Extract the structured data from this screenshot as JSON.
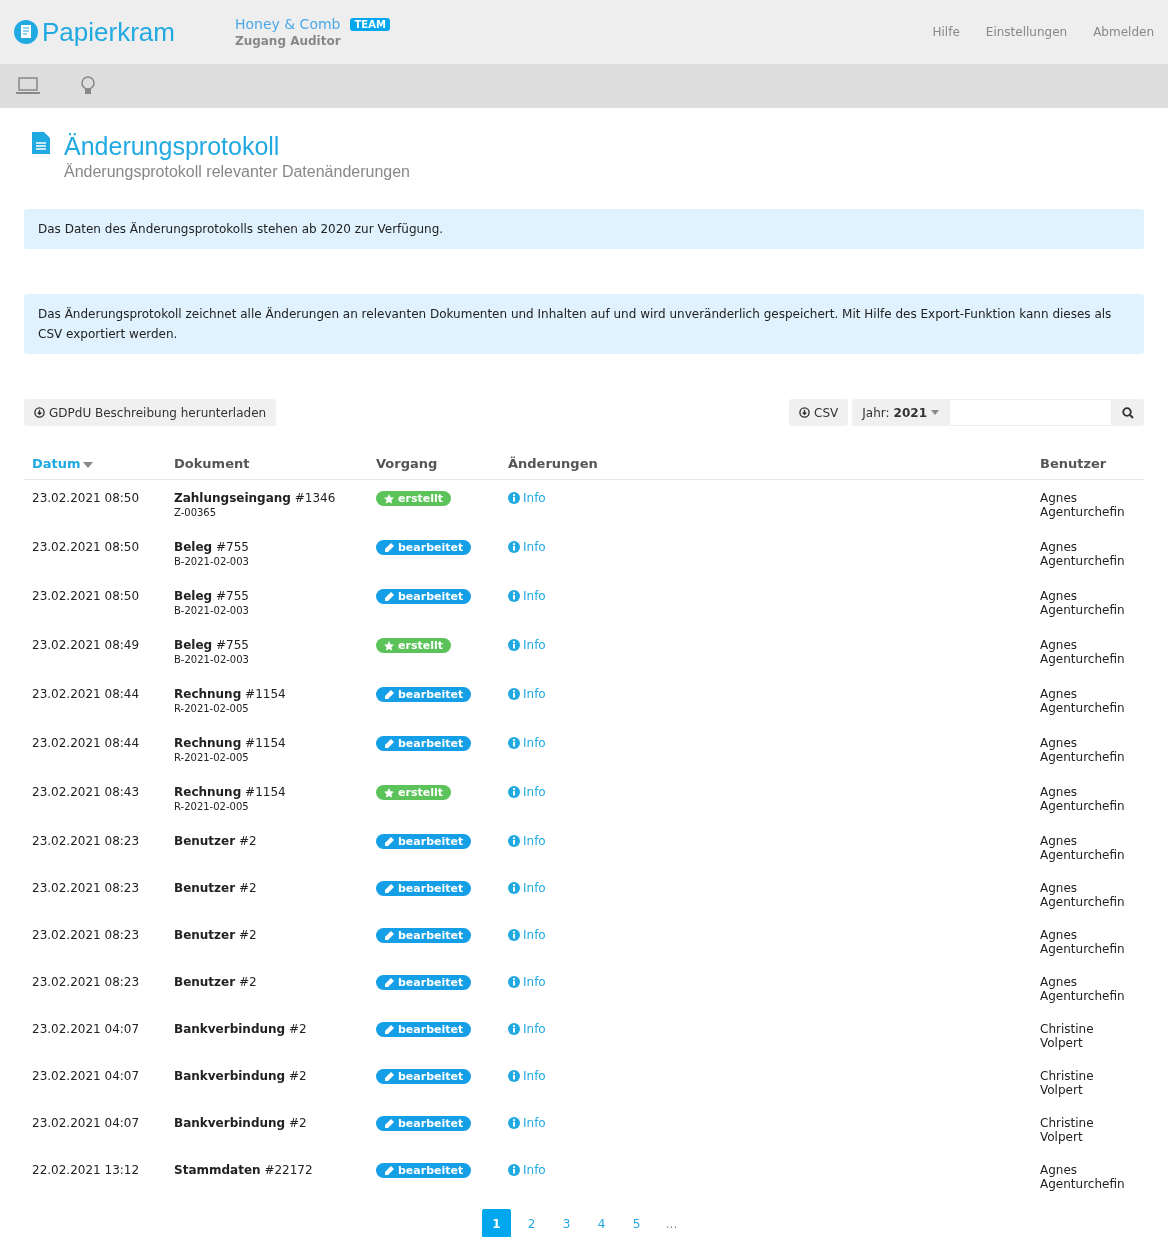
{
  "header": {
    "logo": "Papierkram",
    "company": "Honey & Comb",
    "badge": "TEAM",
    "access": "Zugang Auditor",
    "links": [
      "Hilfe",
      "Einstellungen",
      "Abmelden"
    ]
  },
  "page": {
    "title": "Änderungsprotokoll",
    "subtitle": "Änderungsprotokoll relevanter Datenänderungen"
  },
  "alerts": [
    "Das Daten des Änderungsprotokolls stehen ab 2020 zur Verfügung.",
    "Das Änderungsprotokoll zeichnet alle Änderungen an relevanten Dokumenten und Inhalten auf und wird unveränderlich gespeichert. Mit Hilfe des Export-Funktion kann dieses als CSV exportiert werden."
  ],
  "toolbar": {
    "download": "GDPdU Beschreibung herunterladen",
    "csv": "CSV",
    "year_label": "Jahr:",
    "year": "2021"
  },
  "table": {
    "columns": [
      {
        "label": "Datum",
        "sorted": true
      },
      {
        "label": "Dokument",
        "sorted": false
      },
      {
        "label": "Vorgang",
        "sorted": false
      },
      {
        "label": "Änderungen",
        "sorted": false
      },
      {
        "label": "Benutzer",
        "sorted": false
      }
    ],
    "rows": [
      {
        "date": "23.02.2021 08:50",
        "document": "**Zahlungseingang** #1346",
        "number": "Z-00365",
        "kind": "created",
        "action": "erstellt",
        "changes": "Info",
        "user": "Agnes Agenturchefin"
      },
      {
        "date": "23.02.2021 08:50",
        "document": "**Beleg** #755",
        "number": "B-2021-02-003",
        "kind": "edited",
        "action": "bearbeitet",
        "changes": "Info",
        "user": "Agnes Agenturchefin"
      },
      {
        "date": "23.02.2021 08:50",
        "document": "**Beleg** #755",
        "number": "B-2021-02-003",
        "kind": "edited",
        "action": "bearbeitet",
        "changes": "Info",
        "user": "Agnes Agenturchefin"
      },
      {
        "date": "23.02.2021 08:49",
        "document": "**Beleg** #755",
        "number": "B-2021-02-003",
        "kind": "created",
        "action": "erstellt",
        "changes": "Info",
        "user": "Agnes Agenturchefin"
      },
      {
        "date": "23.02.2021 08:44",
        "document": "**Rechnung** #1154",
        "number": "R-2021-02-005",
        "kind": "edited",
        "action": "bearbeitet",
        "changes": "Info",
        "user": "Agnes Agenturchefin"
      },
      {
        "date": "23.02.2021 08:44",
        "document": "**Rechnung** #1154",
        "number": "R-2021-02-005",
        "kind": "edited",
        "action": "bearbeitet",
        "changes": "Info",
        "user": "Agnes Agenturchefin"
      },
      {
        "date": "23.02.2021 08:43",
        "document": "**Rechnung** #1154",
        "number": "R-2021-02-005",
        "kind": "created",
        "action": "erstellt",
        "changes": "Info",
        "user": "Agnes Agenturchefin"
      },
      {
        "date": "23.02.2021 08:23",
        "document": "**Benutzer** #2",
        "kind": "edited",
        "action": "bearbeitet",
        "changes": "Info",
        "user": "Agnes Agenturchefin"
      },
      {
        "date": "23.02.2021 08:23",
        "document": "**Benutzer** #2",
        "kind": "edited",
        "action": "bearbeitet",
        "changes": "Info",
        "user": "Agnes Agenturchefin"
      },
      {
        "date": "23.02.2021 08:23",
        "document": "**Benutzer** #2",
        "kind": "edited",
        "action": "bearbeitet",
        "changes": "Info",
        "user": "Agnes Agenturchefin"
      },
      {
        "date": "23.02.2021 08:23",
        "document": "**Benutzer** #2",
        "kind": "edited",
        "action": "bearbeitet",
        "changes": "Info",
        "user": "Agnes Agenturchefin"
      },
      {
        "date": "23.02.2021 04:07",
        "document": "**Bankverbindung** #2",
        "kind": "edited",
        "action": "bearbeitet",
        "changes": "Info",
        "user": "Christine Volpert"
      },
      {
        "date": "23.02.2021 04:07",
        "document": "**Bankverbindung** #2",
        "kind": "edited",
        "action": "bearbeitet",
        "changes": "Info",
        "user": "Christine Volpert"
      },
      {
        "date": "23.02.2021 04:07",
        "document": "**Bankverbindung** #2",
        "kind": "edited",
        "action": "bearbeitet",
        "changes": "Info",
        "user": "Christine Volpert"
      },
      {
        "date": "22.02.2021 13:12",
        "document": "**Stammdaten** #22172",
        "kind": "edited",
        "action": "bearbeitet",
        "changes": "Info",
        "user": "Agnes Agenturchefin"
      }
    ]
  },
  "pagination": {
    "pages": [
      {
        "label": "1",
        "selected": true
      },
      {
        "label": "2",
        "selected": false
      },
      {
        "label": "3",
        "selected": false
      },
      {
        "label": "4",
        "selected": false
      },
      {
        "label": "5",
        "selected": false
      }
    ],
    "more": "..."
  }
}
